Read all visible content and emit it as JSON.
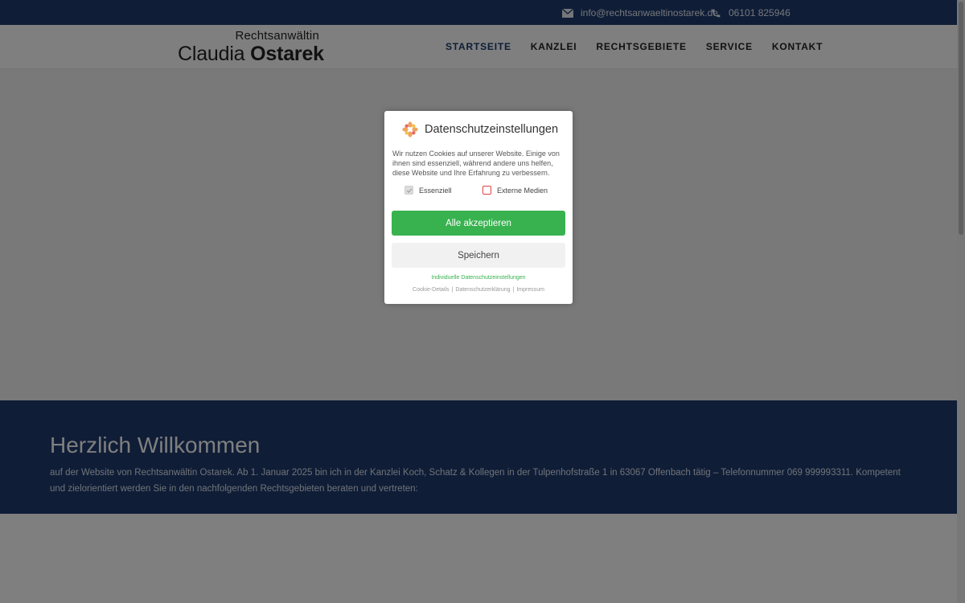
{
  "topbar": {
    "email": "info@rechtsanwaeltinostarek.de",
    "phone": "06101 825946",
    "icons": {
      "email": "envelope-icon",
      "phone": "phone-icon"
    }
  },
  "logo": {
    "small": "Rechtsanwältin",
    "first": "Claudia",
    "last": "Ostarek"
  },
  "nav": {
    "items": [
      "STARTSEITE",
      "KANZLEI",
      "RECHTSGEBIETE",
      "SERVICE",
      "KONTAKT"
    ],
    "active": "STARTSEITE"
  },
  "welcome": {
    "title": "Herzlich Willkommen",
    "text": "auf der Website von Rechtsanwältin Ostarek. Ab 1. Januar 2025 bin ich in der Kanzlei Koch, Schatz & Kollegen in der Tulpenhofstraße 1 in 63067 Offenbach tätig – Telefonnummer 069 999993311. Kompetent und zielorientiert werden Sie in den nachfolgenden Rechtsgebieten beraten und vertreten:"
  },
  "cookie": {
    "title": "Datenschutzeinstellungen",
    "description": "Wir nutzen Cookies auf unserer Website. Einige von ihnen sind essenziell, während andere uns helfen, diese Website und Ihre Erfahrung zu verbessern.",
    "options": [
      {
        "label": "Essenziell",
        "checked": true
      },
      {
        "label": "Externe Medien",
        "checked": false
      }
    ],
    "accept_label": "Alle akzeptieren",
    "save_label": "Speichern",
    "individual_label": "Individuelle Datenschutzeinstellungen",
    "footer_links": [
      "Cookie-Details",
      "Datenschutzerklärung",
      "Impressum"
    ]
  },
  "colors": {
    "brand": "#1e3a6e",
    "accept": "#38b24f",
    "unchecked_border": "#dd4444"
  }
}
